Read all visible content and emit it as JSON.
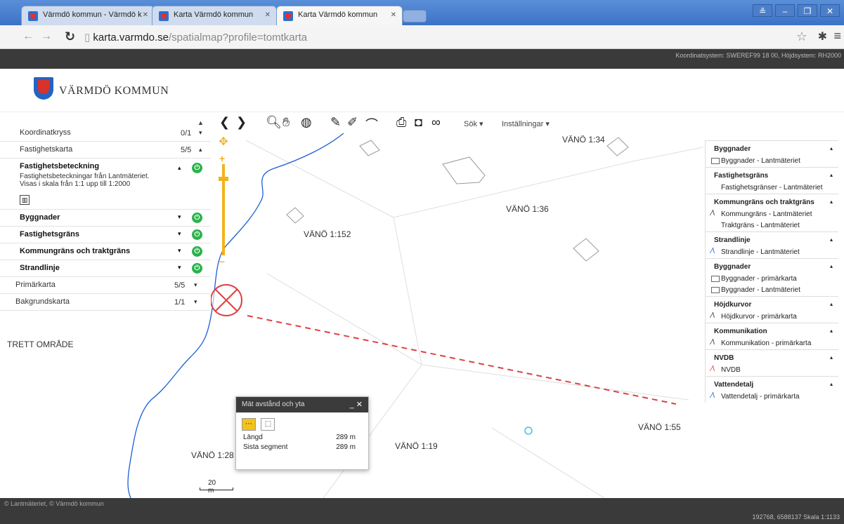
{
  "browser": {
    "tabs": [
      {
        "title": "Värmdö kommun - Värmdö k"
      },
      {
        "title": "Karta Värmdö kommun"
      },
      {
        "title": "Karta Värmdö kommun"
      }
    ],
    "url_host": "karta.varmdo.se",
    "url_path": "/spatialmap?profile=tomtkarta"
  },
  "header": {
    "logo_text": "VÄRMDÖ KOMMUN",
    "coordinate_info": "Koordinatsystem: SWEREF99 18 00, Höjdsystem: RH2000"
  },
  "toolbar": {
    "search_label": "Sök",
    "settings_label": "Inställningar"
  },
  "layers": {
    "rows": [
      {
        "label": "Koordinatkryss",
        "count": "0/1"
      },
      {
        "label": "Fastighetskarta",
        "count": "5/5"
      }
    ],
    "expanded": {
      "title": "Fastighetsbeteckning",
      "desc_line1": "Fastighetsbeteckningar från Lantmäteriet.",
      "desc_line2": "Visas i skala från 1:1 upp till 1:2000"
    },
    "active": [
      "Byggnader",
      "Fastighetsgräns",
      "Kommungräns och traktgräns",
      "Strandlinje"
    ],
    "bottom": [
      {
        "label": "Primärkarta",
        "count": "5/5"
      },
      {
        "label": "Bakgrundskarta",
        "count": "1/1"
      }
    ]
  },
  "map_labels": {
    "top": "VÄNÖ 1:34",
    "l36": "VÄNÖ 1:36",
    "l152": "VÄNÖ 1:152",
    "l55": "VÄNÖ 1:55",
    "l19": "VÄNÖ 1:19",
    "l28": "VÄNÖ 1:28",
    "left_area": "TRETT OMRÅDE"
  },
  "legend": [
    {
      "heading": "Byggnader",
      "items": [
        {
          "sym": "box",
          "text": "Byggnader - Lantmäteriet"
        }
      ]
    },
    {
      "heading": "Fastighetsgräns",
      "items": [
        {
          "sym": "blank",
          "text": "Fastighetsgränser - Lantmäteriet"
        }
      ]
    },
    {
      "heading": "Kommungräns och traktgräns",
      "items": [
        {
          "sym": "line",
          "text": "Kommungräns - Lantmäteriet"
        },
        {
          "sym": "blank",
          "text": "Traktgräns - Lantmäteriet"
        }
      ]
    },
    {
      "heading": "Strandlinje",
      "items": [
        {
          "sym": "blue",
          "text": "Strandlinje - Lantmäteriet"
        }
      ]
    },
    {
      "heading": "Byggnader",
      "items": [
        {
          "sym": "box",
          "text": "Byggnader - primärkarta"
        },
        {
          "sym": "box",
          "text": "Byggnader - Lantmäteriet"
        }
      ]
    },
    {
      "heading": "Höjdkurvor",
      "items": [
        {
          "sym": "line",
          "text": "Höjdkurvor - primärkarta"
        }
      ]
    },
    {
      "heading": "Kommunikation",
      "items": [
        {
          "sym": "line",
          "text": "Kommunikation - primärkarta"
        }
      ]
    },
    {
      "heading": "NVDB",
      "items": [
        {
          "sym": "red",
          "text": "NVDB"
        }
      ]
    },
    {
      "heading": "Vattendetalj",
      "items": [
        {
          "sym": "blue",
          "text": "Vattendetalj - primärkarta"
        }
      ]
    }
  ],
  "measure": {
    "title": "Mät avstånd och yta",
    "length_label": "Längd",
    "length_value": "289 m",
    "segment_label": "Sista segment",
    "segment_value": "289 m"
  },
  "scale": {
    "bar_label": "20 m",
    "readout": "192768, 6588137   Skala 1:1133"
  },
  "footer": {
    "attribution": "© Lantmäteriet, © Värmdö kommun"
  },
  "colors": {
    "accent": "#f2b21d",
    "power": "#2bb24c",
    "measure_line": "#e04040",
    "shore": "#1c5fd6"
  }
}
